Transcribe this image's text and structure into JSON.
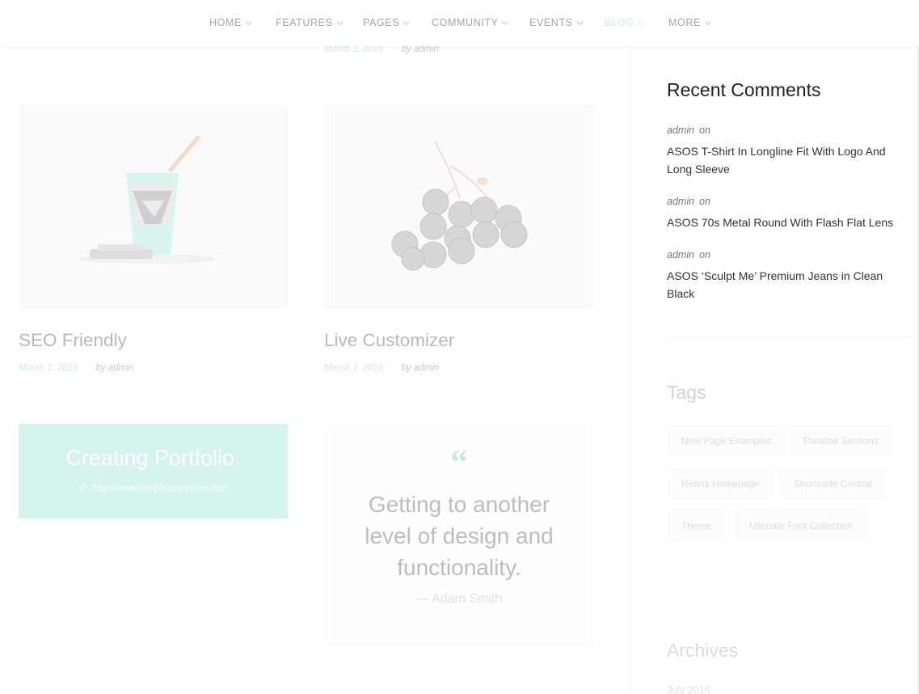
{
  "nav": {
    "items": [
      {
        "label": "HOME"
      },
      {
        "label": "FEATURES"
      },
      {
        "label": "PAGES"
      },
      {
        "label": "COMMUNITY"
      },
      {
        "label": "EVENTS"
      },
      {
        "label": "BLOG"
      },
      {
        "label": "MORE"
      }
    ],
    "active": "BLOG"
  },
  "posts": {
    "top_meta": {
      "date": "March 1, 2016",
      "author": "by admin"
    },
    "items": [
      {
        "title": "SEO Friendly",
        "date": "March 1, 2016",
        "author": "by admin",
        "image": "coffee-cup-icon"
      },
      {
        "title": "Live Customizer",
        "date": "March 1, 2016",
        "author": "by admin",
        "image": "berries-icon"
      }
    ],
    "portfolio": {
      "title": "Creating Portfolio.",
      "link": "http://www.templatemonster.com"
    },
    "quote": {
      "mark": "“",
      "text": "Getting to another level of design and functionality.",
      "author": "— Adam Smith"
    }
  },
  "sidebar": {
    "recent_comments": {
      "title": "Recent Comments",
      "items": [
        {
          "author": "admin",
          "on": "on",
          "link": "ASOS T-Shirt In Longline Fit With Logo And Long Sleeve"
        },
        {
          "author": "admin",
          "on": "on",
          "link": "ASOS 70s Metal Round With Flash Flat Lens"
        },
        {
          "author": "admin",
          "on": "on",
          "link": "ASOS ‘Sculpt Me’ Premium Jeans in Clean Black"
        }
      ]
    },
    "tags": {
      "title": "Tags",
      "items": [
        "New Page Examples",
        "Parallax Sections",
        "Retina Homepage",
        "Shortcode Central",
        "Theme",
        "Ultimate Font Collection"
      ]
    },
    "archives": {
      "title": "Archives",
      "items": [
        "July 2016"
      ]
    }
  },
  "colors": {
    "accent": "#c8f0e7",
    "portfolio_bg": "#d5f4ec"
  }
}
